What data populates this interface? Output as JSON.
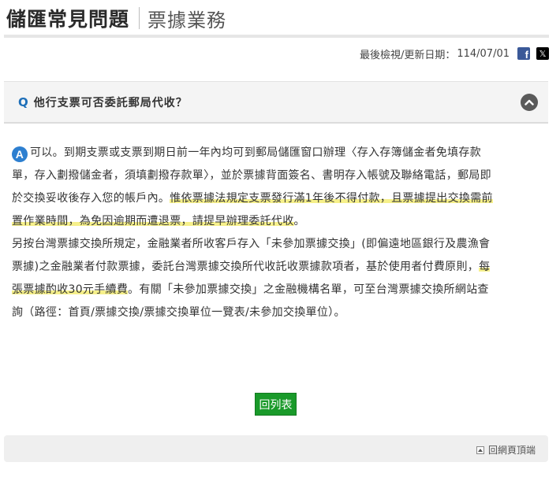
{
  "header": {
    "title": "儲匯常見問題",
    "subtitle": "票據業務"
  },
  "update": {
    "label": "最後檢視/更新日期：",
    "date": "114/07/01",
    "share_icons": [
      "facebook-icon",
      "x-icon"
    ],
    "fb_glyph": "f",
    "x_glyph": "𝕏"
  },
  "question": {
    "mark": "Q",
    "text": "他行支票可否委託郵局代收？"
  },
  "answer": {
    "mark": "A",
    "p1_plain": "可以。到期支票或支票到期日前一年內均可到郵局儲匯窗口辦理〈存入存簿儲金者免填存款單，存入劃撥儲金者，須填劃撥存款單〉，並於票據背面簽名、書明存入帳號及聯絡電話，郵局即於交換妥收後存入您的帳戶內。",
    "p1_highlight": "惟依票據法規定支票發行滿1年後不得付款，且票據提出交換需前置作業時間，為免因逾期而遭退票，請提早辦理委託代收",
    "p1_end": "。",
    "p2_plain_a": "另按台灣票據交換所規定，金融業者所收客戶存入「未參加票據交換」(即偏遠地區銀行及農漁會票據)之金融業者付款票據，委託台灣票據交換所代收託收票據款項者，基於使用者付費原則，",
    "p2_highlight": "每張票據酌收30元手續費",
    "p2_plain_b": "。有關「未參加票據交換」之金融機構名單，可至台灣票據交換所網站查詢（路徑：首頁/票據交換/票據交換單位一覽表/未參加交換單位）。"
  },
  "buttons": {
    "back_to_list": "回列表",
    "back_to_top": "回網頁頂端"
  },
  "colors": {
    "accent_blue": "#2d7fd0",
    "button_green": "#1a9a2a",
    "highlight_yellow": "#f6f08a"
  }
}
